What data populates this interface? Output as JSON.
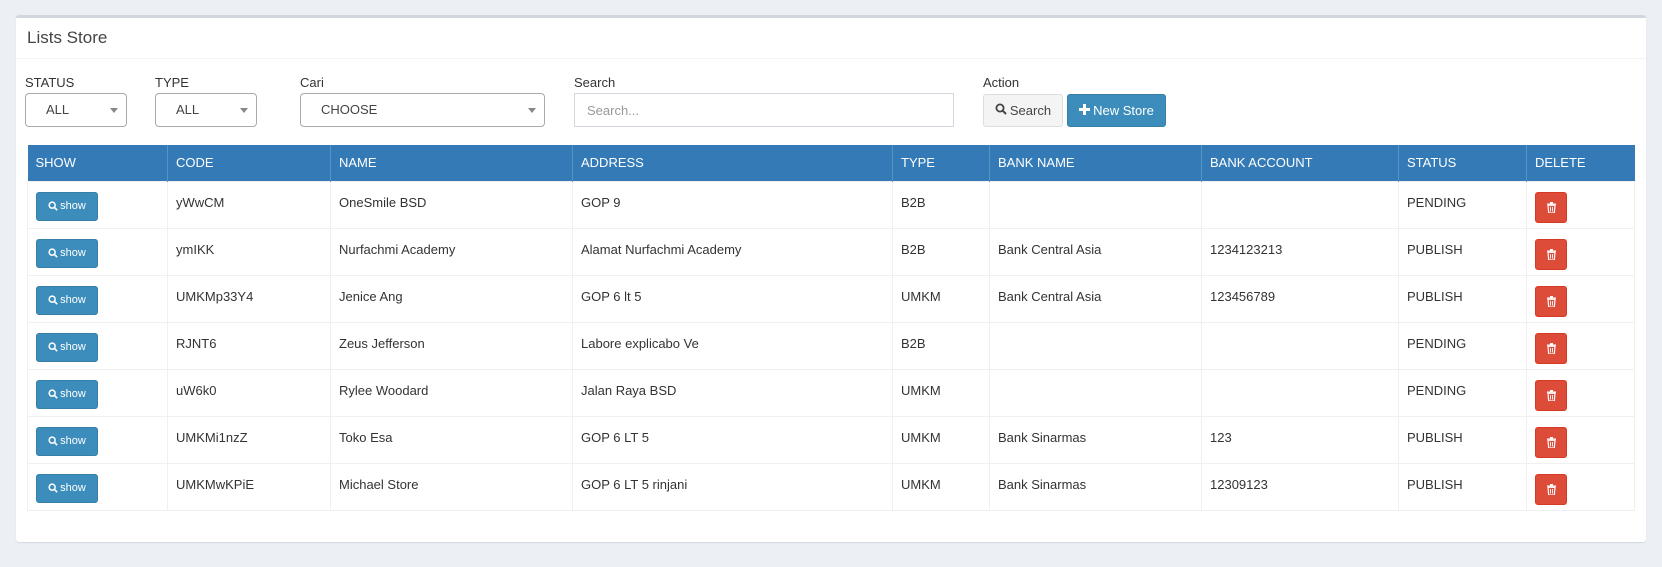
{
  "box": {
    "title": "Lists Store"
  },
  "filters": {
    "status": {
      "label": "STATUS",
      "value": "ALL"
    },
    "type": {
      "label": "TYPE",
      "value": "ALL"
    },
    "cari": {
      "label": "Cari",
      "value": "CHOOSE"
    },
    "search": {
      "label": "Search",
      "placeholder": "Search..."
    },
    "action": {
      "label": "Action",
      "search_button": "Search",
      "new_store_button": "New Store"
    }
  },
  "colors": {
    "primary": "#3c8dbc",
    "header": "#337ab7",
    "danger": "#dd4b39"
  },
  "table": {
    "headers": [
      "SHOW",
      "CODE",
      "NAME",
      "ADDRESS",
      "TYPE",
      "BANK NAME",
      "BANK ACCOUNT",
      "STATUS",
      "DELETE"
    ],
    "show_label": "show",
    "rows": [
      {
        "code": "yWwCM",
        "name": "OneSmile BSD",
        "address": "GOP 9",
        "type": "B2B",
        "bank_name": "",
        "bank_account": "",
        "status": "PENDING"
      },
      {
        "code": "ymIKK",
        "name": "Nurfachmi Academy",
        "address": "Alamat Nurfachmi Academy",
        "type": "B2B",
        "bank_name": "Bank Central Asia",
        "bank_account": "1234123213",
        "status": "PUBLISH"
      },
      {
        "code": "UMKMp33Y4",
        "name": "Jenice Ang",
        "address": "GOP 6 lt 5",
        "type": "UMKM",
        "bank_name": "Bank Central Asia",
        "bank_account": "123456789",
        "status": "PUBLISH"
      },
      {
        "code": "RJNT6",
        "name": "Zeus Jefferson",
        "address": "Labore explicabo Ve",
        "type": "B2B",
        "bank_name": "",
        "bank_account": "",
        "status": "PENDING"
      },
      {
        "code": "uW6k0",
        "name": "Rylee Woodard",
        "address": "Jalan Raya BSD",
        "type": "UMKM",
        "bank_name": "",
        "bank_account": "",
        "status": "PENDING"
      },
      {
        "code": "UMKMi1nzZ",
        "name": "Toko Esa",
        "address": "GOP 6 LT 5",
        "type": "UMKM",
        "bank_name": "Bank Sinarmas",
        "bank_account": "123",
        "status": "PUBLISH"
      },
      {
        "code": "UMKMwKPiE",
        "name": "Michael Store",
        "address": "GOP 6 LT 5 rinjani",
        "type": "UMKM",
        "bank_name": "Bank Sinarmas",
        "bank_account": "12309123",
        "status": "PUBLISH"
      }
    ]
  }
}
